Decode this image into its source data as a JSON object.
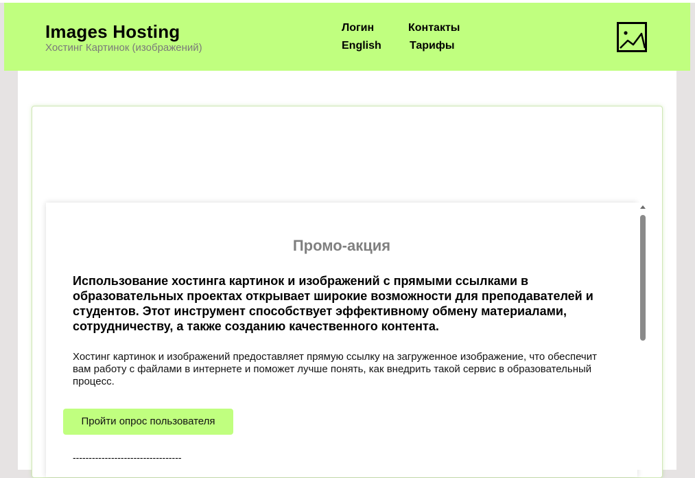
{
  "header": {
    "title": "Images Hosting",
    "subtitle": "Хостинг Картинок (изображений)",
    "nav": {
      "login": "Логин",
      "contacts": "Контакты",
      "english": "English",
      "tariffs": "Тарифы"
    },
    "logo_icon": "image-icon"
  },
  "promo": {
    "title": "Промо-акция",
    "lead": "Использование хостинга картинок и изображений с прямыми ссылками в образовательных проектах открывает широкие возможности для преподавателей и студентов. Этот инструмент способствует эффективному обмену материалами, сотрудничеству, а также созданию качественного контента.",
    "body": "Хостинг картинок и изображений предоставляет прямую ссылку на загруженное изображение, что обеспечит вам работу с файлами в интернете и поможет лучше понять, как внедрить такой сервис в образовательный процесс.",
    "survey_button": "Пройти опрос пользователя",
    "divider": "----------------------------------"
  },
  "colors": {
    "accent": "#c0ff7f",
    "muted_text": "#808080",
    "background": "#e6e3e3"
  }
}
